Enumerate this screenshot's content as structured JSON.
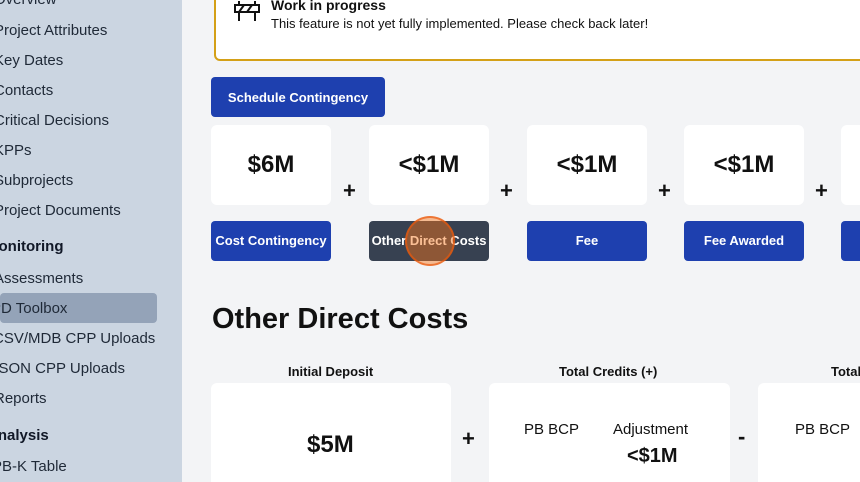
{
  "sidebar": {
    "items": [
      {
        "label": "Overview"
      },
      {
        "label": "Project Attributes"
      },
      {
        "label": "Key Dates"
      },
      {
        "label": "Contacts"
      },
      {
        "label": "Critical Decisions"
      },
      {
        "label": "KPPs"
      },
      {
        "label": "Subprojects"
      },
      {
        "label": "Project Documents"
      }
    ],
    "monitoring_heading": "Monitoring",
    "monitoring_items": [
      {
        "label": "Assessments"
      },
      {
        "label": "PD Toolbox"
      },
      {
        "label": "CSV/MDB CPP Uploads"
      },
      {
        "label": "JSON CPP Uploads"
      },
      {
        "label": "Reports"
      }
    ],
    "analysis_heading": "Analysis",
    "analysis_items": [
      {
        "label": "PB-K Table"
      }
    ]
  },
  "banner": {
    "title": "Work in progress",
    "message": "This feature is not yet fully implemented. Please check back later!"
  },
  "schedule_button": "Schedule Contingency",
  "cards": [
    {
      "value": "$6M",
      "label": "Cost Contingency"
    },
    {
      "value": "<$1M",
      "label": "Other Direct Costs"
    },
    {
      "value": "<$1M",
      "label": "Fee"
    },
    {
      "value": "<$1M",
      "label": "Fee Awarded"
    }
  ],
  "operators": {
    "plus": "+",
    "minus": "-"
  },
  "section": {
    "title": "Other Direct Costs",
    "columns": [
      "Initial Deposit",
      "Total Credits (+)",
      "Total"
    ],
    "initial_deposit": "$5M",
    "credits": {
      "pb_bcp": "PB BCP",
      "adjustment": "Adjustment",
      "adjustment_value": "<$1M"
    },
    "debits": {
      "pb_bcp": "PB BCP"
    }
  },
  "colors": {
    "sidebar": "#cbd5e1",
    "primary": "#1e40af",
    "active_label": "#374151",
    "banner_border": "#d4a017"
  }
}
